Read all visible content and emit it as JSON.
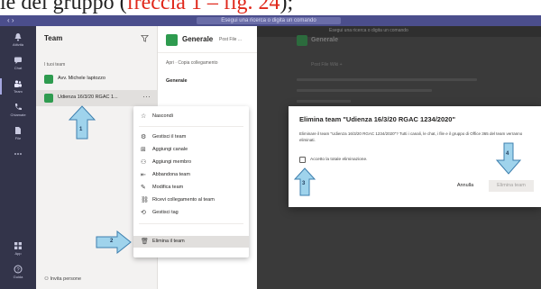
{
  "caption": {
    "prefix": "le del gruppo (",
    "red": "freccia 1 – fig. 24",
    "suffix": ");"
  },
  "topbar": {
    "nav": "‹  ›",
    "search": "Esegui una ricerca o digita un comando",
    "compose": "☑"
  },
  "rail": {
    "items": [
      {
        "label": "Attività",
        "icon": "bell-icon"
      },
      {
        "label": "Chat",
        "icon": "chat-icon"
      },
      {
        "label": "Team",
        "icon": "teams-icon"
      },
      {
        "label": "Chiamate",
        "icon": "phone-icon"
      },
      {
        "label": "File",
        "icon": "file-icon"
      },
      {
        "label": "...",
        "icon": "more-icon"
      },
      {
        "label": "App",
        "icon": "apps-icon"
      },
      {
        "label": "Guida",
        "icon": "help-icon"
      }
    ]
  },
  "teams": {
    "title": "Team",
    "filter_icon": "filter-icon",
    "group_label": "I tuoi team",
    "rows": [
      {
        "name": "Avv. Michele Iaptozzo",
        "selected": false
      },
      {
        "name": "Udienza 16/3/20 RGAC 1...",
        "selected": true
      }
    ],
    "invite": "Invita persone"
  },
  "channel": {
    "name": "Generale",
    "tabs": "Post   File   ...",
    "sub": "Apri  ·  Copia collegamento",
    "section": "Generale"
  },
  "dark": {
    "title": "Esegui una ricerca o digita un comando",
    "ghost_name": "Generale",
    "ghost_sub": "Post   File   Wiki   +"
  },
  "menu": {
    "items": [
      {
        "icon": "☆",
        "label": "Nascondi"
      },
      {
        "icon": "⚙",
        "label": "Gestisci il team"
      },
      {
        "icon": "⊞",
        "label": "Aggiungi canale"
      },
      {
        "icon": "⚇",
        "label": "Aggiungi membro"
      },
      {
        "icon": "⇤",
        "label": "Abbandona team"
      },
      {
        "icon": "✎",
        "label": "Modifica team"
      },
      {
        "icon": "⛓",
        "label": "Ricevi collegamento al team"
      },
      {
        "icon": "⟲",
        "label": "Gestisci tag"
      },
      {
        "icon": "🗑",
        "label": "Elimina il team"
      }
    ]
  },
  "dialog": {
    "title": "Elimina team \"Udienza 16/3/20 RGAC 1234/2020\"",
    "body": "Eliminare il team \"Udienza 16/3/20 RGAC 1234/2020\"? Tutti i canali, le chat, i file e il gruppo di Office 365 del team verranno eliminati.",
    "checkbox_label": "Accetto la totale eliminazione.",
    "cancel": "Annulla",
    "delete": "Elimina team"
  },
  "annotations": [
    "1",
    "2",
    "3",
    "4"
  ],
  "colors": {
    "accent": "#4b4e8c",
    "rail": "#33344a",
    "team_avatar": "#2e9b4f",
    "arrow_fill": "#9fd3ec",
    "caption_red": "#e0281b"
  }
}
